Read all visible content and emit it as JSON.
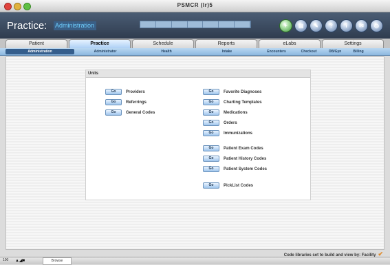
{
  "window": {
    "title": "PSMCR (Ir)5"
  },
  "header": {
    "app_title": "Practice:",
    "section": "Administration",
    "quick_nav": [
      "",
      "",
      "",
      "",
      "",
      "",
      ""
    ],
    "tool_icons": [
      "plus-icon",
      "printer-icon",
      "tools-icon",
      "help-icon",
      "info-icon",
      "mail-icon",
      "target-icon"
    ]
  },
  "tabs": [
    {
      "label": "Patient"
    },
    {
      "label": "Practice"
    },
    {
      "label": "Schedule"
    },
    {
      "label": "Reports"
    },
    {
      "label": "eLabs"
    },
    {
      "label": "Settings"
    }
  ],
  "subtabs": [
    {
      "label": "Administration"
    },
    {
      "label": "Administrator"
    },
    {
      "label": "Health"
    },
    {
      "label": "Intake"
    },
    {
      "label": "Encounters"
    },
    {
      "label": "Checkout"
    },
    {
      "label": "OB/Gyn"
    },
    {
      "label": "Billing"
    }
  ],
  "codes_panel": {
    "title": "Units",
    "go_label": "Go",
    "left_items": [
      {
        "label": "Providers"
      },
      {
        "label": "Referrings"
      },
      {
        "label": "General Codes"
      }
    ],
    "right_items": [
      {
        "label": "Favorite Diagnoses"
      },
      {
        "label": "Charting Templates"
      },
      {
        "label": "Medications"
      },
      {
        "label": "Orders"
      },
      {
        "label": "Immunizations"
      },
      {
        "label": "Patient Exam Codes"
      },
      {
        "label": "Patient History Codes"
      },
      {
        "label": "Patient System Codes"
      },
      {
        "label": "PickList Codes"
      }
    ]
  },
  "status": {
    "message": "Code libraries set to build and view by: Facility"
  },
  "bottom": {
    "zoom": "100",
    "tab": "Browse"
  },
  "colors": {
    "accent": "#355e8c",
    "header": "#3a4a60",
    "go_button": "#9fc5ec"
  }
}
